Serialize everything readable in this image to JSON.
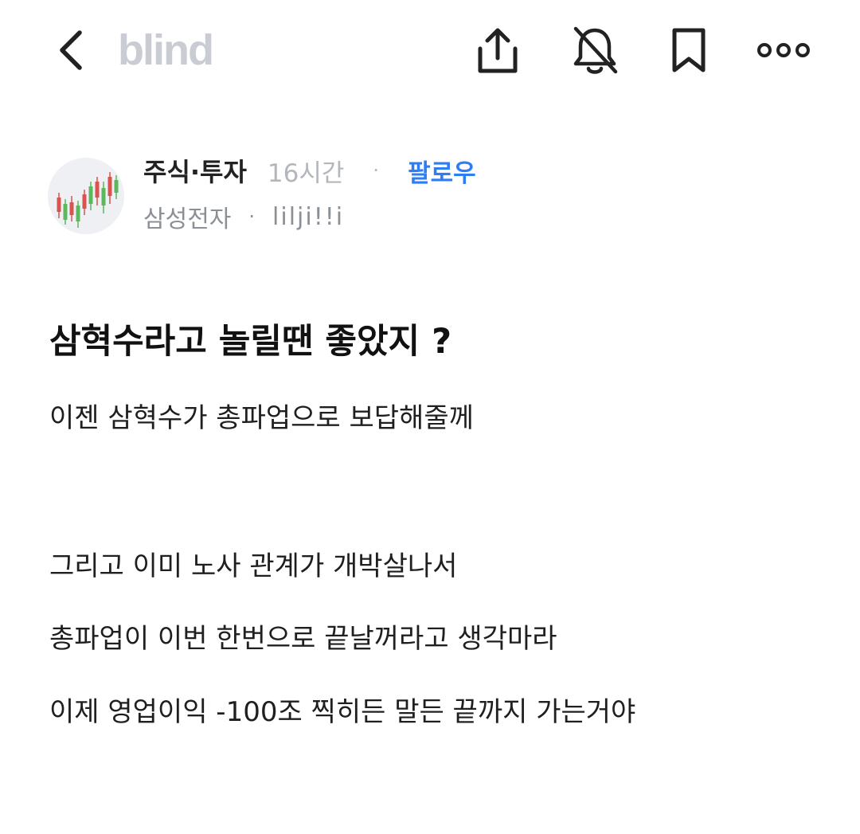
{
  "header": {
    "brand": "blind",
    "icons": {
      "back": "back-arrow-icon",
      "share": "share-icon",
      "notification": "bell-off-icon",
      "bookmark": "bookmark-icon",
      "more": "more-dots-icon"
    }
  },
  "post": {
    "board": "주식·투자",
    "time": "16시간",
    "separator": "·",
    "follow_label": "팔로우",
    "company": "삼성전자",
    "author": "lilji!!i",
    "title": "삼혁수라고 놀릴땐 좋았지 ?",
    "body": [
      "이젠 삼혁수가 총파업으로 보답해줄께",
      "그리고 이미 노사 관계가 개박살나서",
      "총파업이 이번 한번으로 끝날꺼라고 생각마라",
      "이제 영업이익 -100조 찍히든 말든 끝까지 가는거야"
    ]
  },
  "colors": {
    "accent": "#2f7df2",
    "brand": "#c9ccd2",
    "muted": "#8b9097",
    "faint": "#b3b7bd"
  }
}
